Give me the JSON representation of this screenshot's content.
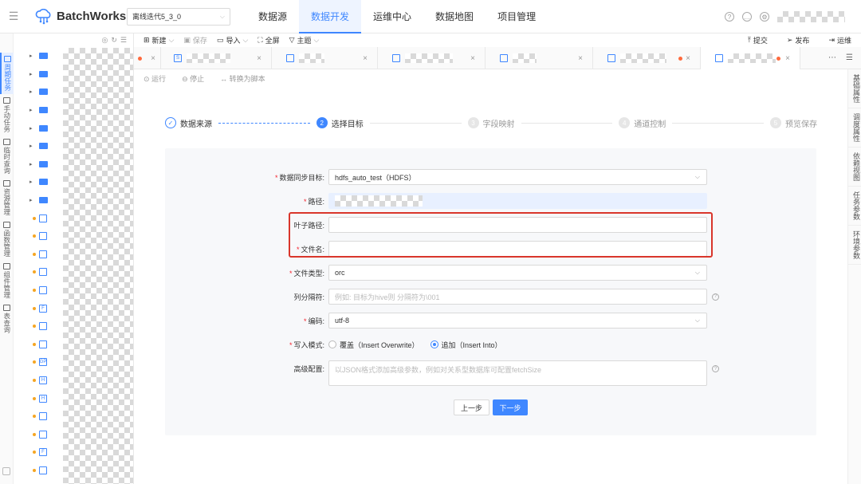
{
  "app": {
    "name": "BatchWorks",
    "project": "离线迭代5_3_0"
  },
  "nav": [
    {
      "label": "数据源",
      "active": false
    },
    {
      "label": "数据开发",
      "active": true
    },
    {
      "label": "运维中心",
      "active": false
    },
    {
      "label": "数据地图",
      "active": false
    },
    {
      "label": "项目管理",
      "active": false
    }
  ],
  "rail": [
    {
      "label": "周期任务",
      "active": true
    },
    {
      "label": "手动任务",
      "active": false
    },
    {
      "label": "临时查询",
      "active": false
    },
    {
      "label": "资源管理",
      "active": false
    },
    {
      "label": "函数管理",
      "active": false
    },
    {
      "label": "组件管理",
      "active": false
    },
    {
      "label": "表查询",
      "active": false
    }
  ],
  "toolbar": {
    "new": "新建",
    "save": "保存",
    "import": "导入",
    "fullscreen": "全屏",
    "theme": "主题",
    "submit": "提交",
    "publish": "发布",
    "ops": "运维"
  },
  "actionbar": {
    "run": "运行",
    "stop": "停止",
    "convert": "转换为脚本"
  },
  "right_rail": [
    "基础属性",
    "调度属性",
    "依赖视图",
    "任务参数",
    "环境参数"
  ],
  "steps": [
    {
      "num": "",
      "label": "数据来源",
      "state": "done"
    },
    {
      "num": "2",
      "label": "选择目标",
      "state": "current"
    },
    {
      "num": "3",
      "label": "字段映射",
      "state": "todo"
    },
    {
      "num": "4",
      "label": "通道控制",
      "state": "todo"
    },
    {
      "num": "5",
      "label": "预览保存",
      "state": "todo"
    }
  ],
  "form": {
    "target_label": "数据同步目标:",
    "target_value": "hdfs_auto_test（HDFS）",
    "path_label": "路径:",
    "leaf_path_label": "叶子路径:",
    "leaf_path_value": "",
    "file_name_label": "文件名:",
    "file_name_value": "",
    "file_type_label": "文件类型:",
    "file_type_value": "orc",
    "delimiter_label": "列分隔符:",
    "delimiter_placeholder": "例如: 目标为hive则 分隔符为\\001",
    "encoding_label": "编码:",
    "encoding_value": "utf-8",
    "write_mode_label": "写入模式:",
    "write_mode_options": [
      {
        "label": "覆盖（Insert Overwrite）",
        "selected": false
      },
      {
        "label": "追加（Insert Into）",
        "selected": true
      }
    ],
    "advanced_label": "高级配置:",
    "advanced_placeholder": "以JSON格式添加高级参数，例如对关系型数据库可配置fetchSize"
  },
  "buttons": {
    "prev": "上一步",
    "next": "下一步"
  },
  "colors": {
    "accent": "#3f87ff",
    "highlight": "#d9362b",
    "required": "#f5222d"
  }
}
